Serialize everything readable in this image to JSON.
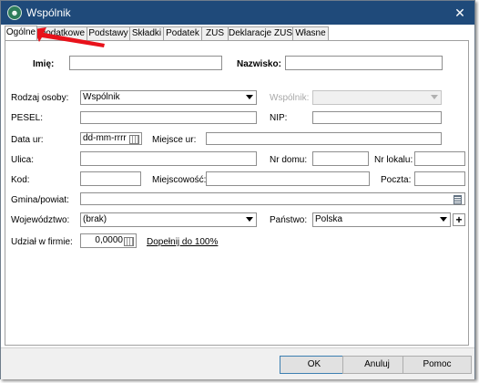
{
  "window": {
    "title": "Wspólnik"
  },
  "tabs": [
    {
      "label": "Ogólne",
      "active": true
    },
    {
      "label": "Dodatkowe"
    },
    {
      "label": "Podstawy"
    },
    {
      "label": "Składki"
    },
    {
      "label": "Podatek"
    },
    {
      "label": "ZUS"
    },
    {
      "label": "Deklaracje ZUS"
    },
    {
      "label": "Własne"
    }
  ],
  "form": {
    "imie": {
      "label": "Imię:",
      "value": ""
    },
    "nazwisko": {
      "label": "Nazwisko:",
      "value": ""
    },
    "rodzaj_osoby": {
      "label": "Rodzaj osoby:",
      "value": "Wspólnik"
    },
    "wspolnik": {
      "label": "Wspólnik:",
      "value": ""
    },
    "pesel": {
      "label": "PESEL:",
      "value": ""
    },
    "nip": {
      "label": "NIP:",
      "value": ""
    },
    "data_ur": {
      "label": "Data ur:",
      "placeholder": "dd-mm-rrrr"
    },
    "miejsce_ur": {
      "label": "Miejsce ur:",
      "value": ""
    },
    "ulica": {
      "label": "Ulica:",
      "value": ""
    },
    "nr_domu": {
      "label": "Nr domu:",
      "value": ""
    },
    "nr_lokalu": {
      "label": "Nr lokalu:",
      "value": ""
    },
    "kod": {
      "label": "Kod:",
      "value": ""
    },
    "miejscowosc": {
      "label": "Miejscowość:",
      "value": ""
    },
    "poczta": {
      "label": "Poczta:",
      "value": ""
    },
    "gmina": {
      "label": "Gmina/powiat:",
      "value": ""
    },
    "wojewodztwo": {
      "label": "Województwo:",
      "value": "(brak)"
    },
    "panstwo": {
      "label": "Państwo:",
      "value": "Polska",
      "add_label": "+"
    },
    "udzial": {
      "label": "Udział w firmie:",
      "value": "0,0000",
      "link": "Dopełnij do 100%"
    }
  },
  "buttons": {
    "ok": "OK",
    "cancel": "Anuluj",
    "help": "Pomoc"
  },
  "colors": {
    "titlebar": "#1f4a7a",
    "annotation_arrow": "#e8121b"
  },
  "icons": {
    "app": "partner-icon",
    "close": "close-icon",
    "calendar": "calendar-icon",
    "list": "list-icon",
    "pointer": "red-arrow-icon"
  }
}
